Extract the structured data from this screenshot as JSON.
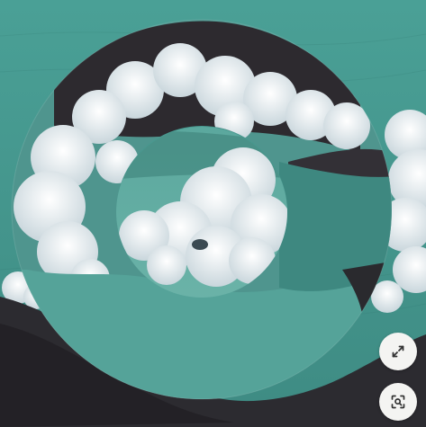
{
  "image": {
    "subject": "circular-collage-ocean-clouds"
  },
  "controls": {
    "expand_icon": "expand-arrows-icon",
    "visual_search_icon": "visual-search-icon"
  },
  "colors": {
    "sea": "#4f9a91",
    "sea_inner": "#62aca2",
    "cloud": "#eef3f5",
    "rock": "#2c2b30",
    "button_bg": "#f4f4f2",
    "icon": "#333333"
  }
}
